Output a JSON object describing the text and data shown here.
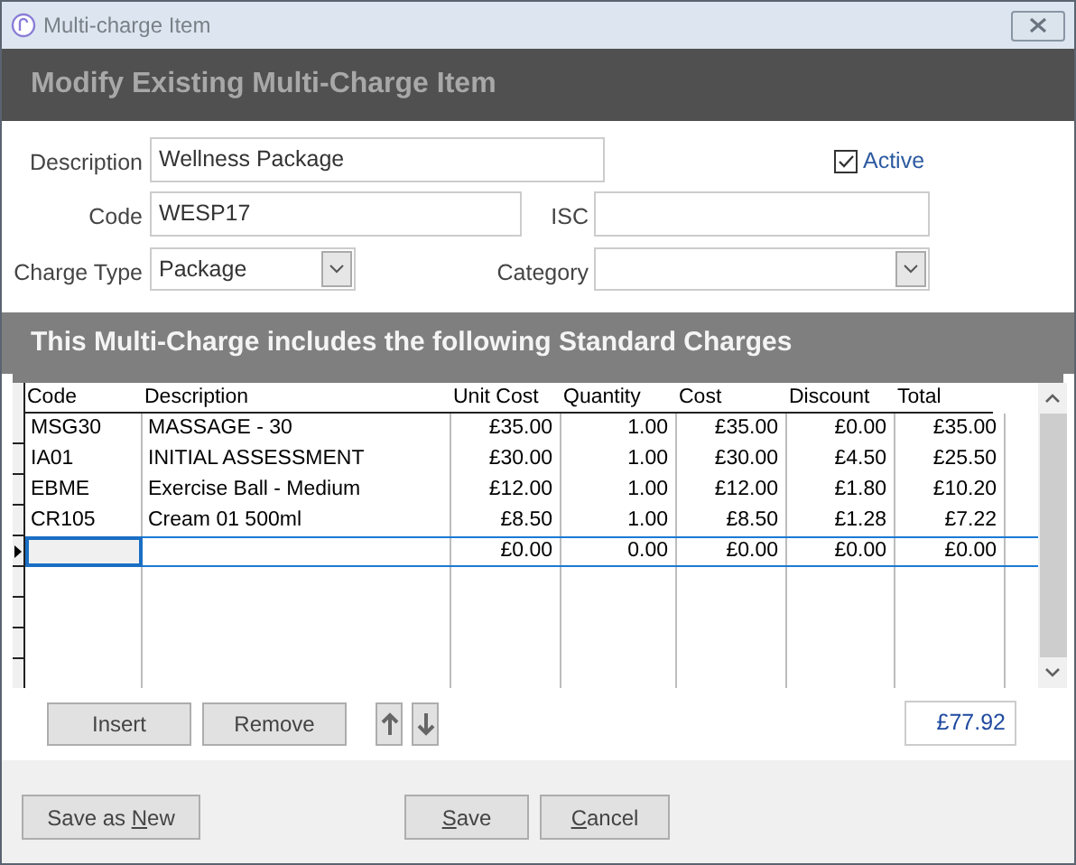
{
  "window": {
    "title": "Multi-charge Item"
  },
  "header": "Modify Existing Multi-Charge Item",
  "form": {
    "description": {
      "label": "Description",
      "value": "Wellness Package"
    },
    "active": {
      "label": "Active",
      "checked": true
    },
    "code": {
      "label": "Code",
      "value": "WESP17"
    },
    "isc": {
      "label": "ISC"
    },
    "charge_type": {
      "label": "Charge Type",
      "value": "Package"
    },
    "category": {
      "label": "Category"
    }
  },
  "section_title": "This Multi-Charge includes the following Standard Charges",
  "table": {
    "columns": [
      "Code",
      "Description",
      "Unit Cost",
      "Quantity",
      "Cost",
      "Discount",
      "Total"
    ],
    "rows": [
      {
        "current": false,
        "cells": [
          "MSG30",
          "MASSAGE - 30",
          "£35.00",
          "1.00",
          "£35.00",
          "£0.00",
          "£35.00"
        ]
      },
      {
        "current": false,
        "cells": [
          "IA01",
          "INITIAL ASSESSMENT",
          "£30.00",
          "1.00",
          "£30.00",
          "£4.50",
          "£25.50"
        ]
      },
      {
        "current": false,
        "cells": [
          "EBME",
          "Exercise Ball - Medium",
          "£12.00",
          "1.00",
          "£12.00",
          "£1.80",
          "£10.20"
        ]
      },
      {
        "current": false,
        "cells": [
          "CR105",
          "Cream 01 500ml",
          "£8.50",
          "1.00",
          "£8.50",
          "£1.28",
          "£7.22"
        ]
      },
      {
        "current": true,
        "cells": [
          null,
          null,
          "£0.00",
          "0.00",
          "£0.00",
          "£0.00",
          "£0.00"
        ]
      }
    ]
  },
  "grid_buttons": [
    "Insert",
    "Remove"
  ],
  "total": "£77.92",
  "footer_buttons": [
    {
      "before": "Save as ",
      "mnemonic": "N",
      "after": "ew"
    },
    {
      "mnemonic": "S",
      "after": "ave"
    },
    {
      "mnemonic": "C",
      "after": "ancel"
    }
  ]
}
